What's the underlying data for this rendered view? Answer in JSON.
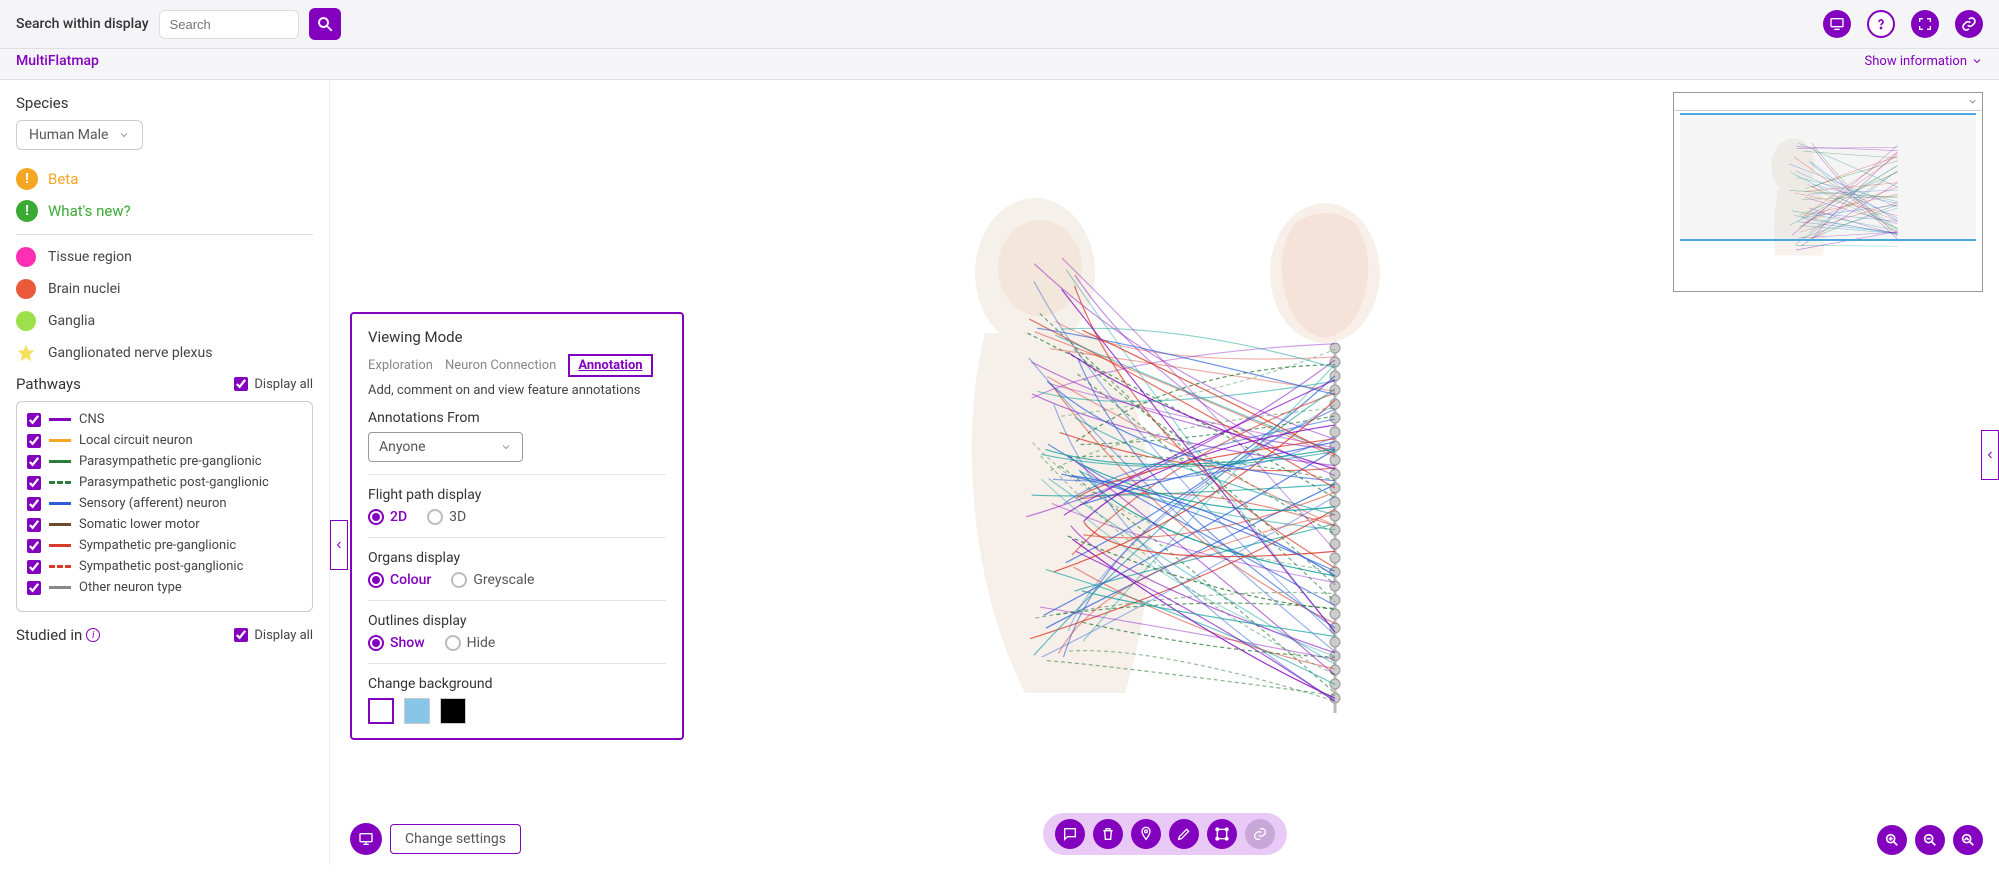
{
  "header": {
    "search_label": "Search within display",
    "search_placeholder": "Search",
    "app_name": "MultiFlatmap",
    "show_info": "Show information"
  },
  "sidebar": {
    "species_label": "Species",
    "species_value": "Human Male",
    "beta": "Beta",
    "whats_new": "What's new?",
    "legend": {
      "tissue": "Tissue region",
      "nuclei": "Brain nuclei",
      "ganglia": "Ganglia",
      "plexus": "Ganglionated nerve plexus"
    },
    "pathways_label": "Pathways",
    "display_all": "Display all",
    "pathways": [
      {
        "label": "CNS",
        "color": "#8300bf",
        "dashed": false
      },
      {
        "label": "Local circuit neuron",
        "color": "#f5a623",
        "dashed": false
      },
      {
        "label": "Parasympathetic pre-ganglionic",
        "color": "#2d7d3a",
        "dashed": false
      },
      {
        "label": "Parasympathetic post-ganglionic",
        "color": "#2d7d3a",
        "dashed": true
      },
      {
        "label": "Sensory (afferent) neuron",
        "color": "#2a5fd8",
        "dashed": false
      },
      {
        "label": "Somatic lower motor",
        "color": "#6b4a2e",
        "dashed": false
      },
      {
        "label": "Sympathetic pre-ganglionic",
        "color": "#d83a2a",
        "dashed": false
      },
      {
        "label": "Sympathetic post-ganglionic",
        "color": "#d83a2a",
        "dashed": true
      },
      {
        "label": "Other neuron type",
        "color": "#888888",
        "dashed": false
      }
    ],
    "studied_in": "Studied in"
  },
  "settings_panel": {
    "title": "Viewing Mode",
    "tabs": {
      "exploration": "Exploration",
      "neuron": "Neuron Connection",
      "annotation": "Annotation"
    },
    "description": "Add, comment on and view feature annotations",
    "annotations_from_label": "Annotations From",
    "annotations_from_value": "Anyone",
    "flight_label": "Flight path display",
    "flight_2d": "2D",
    "flight_3d": "3D",
    "organs_label": "Organs display",
    "organs_colour": "Colour",
    "organs_greyscale": "Greyscale",
    "outlines_label": "Outlines display",
    "outlines_show": "Show",
    "outlines_hide": "Hide",
    "background_label": "Change background"
  },
  "bottom": {
    "change_settings": "Change settings"
  },
  "colors": {
    "tissue": "#ff2fb3",
    "nuclei": "#e85a3a",
    "ganglia": "#9de04a",
    "plexus": "#f5e05a",
    "bg_white": "#ffffff",
    "bg_blue": "#87c6e8",
    "bg_black": "#000000"
  }
}
